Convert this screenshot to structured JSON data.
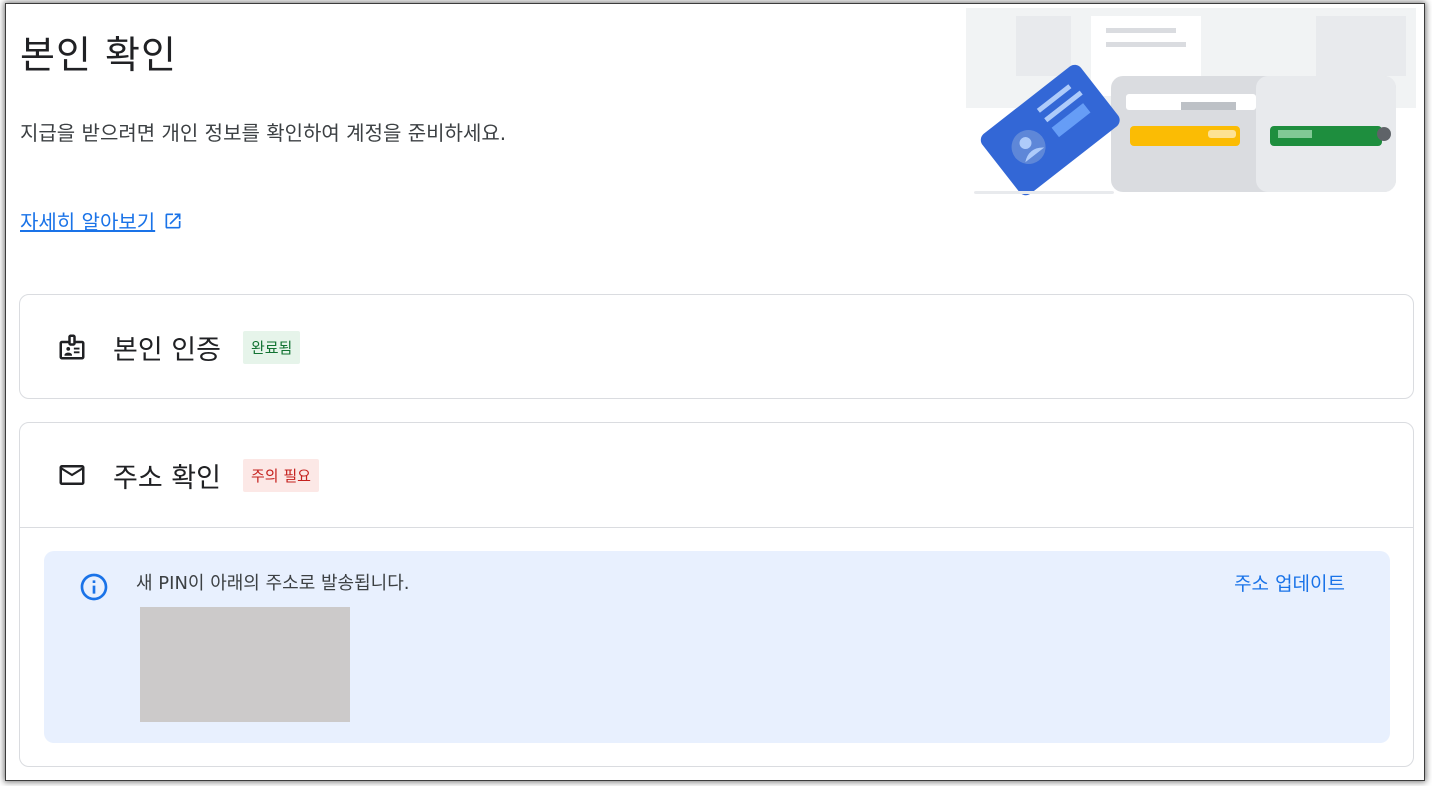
{
  "header": {
    "title": "본인 확인",
    "description": "지급을 받으려면 개인 정보를 확인하여 계정을 준비하세요.",
    "learn_more": "자세히 알아보기"
  },
  "identity": {
    "label": "본인 인증",
    "status": "완료됨"
  },
  "address": {
    "label": "주소 확인",
    "status": "주의 필요",
    "notice": "새 PIN이 아래의 주소로 발송됩니다.",
    "update_link": "주소 업데이트"
  },
  "colors": {
    "link": "#1a73e8",
    "success_bg": "#e6f4ea",
    "success_text": "#137333",
    "warning_bg": "#fce8e6",
    "warning_text": "#c5221f",
    "notice_bg": "#e8f0fe"
  },
  "icons": {
    "identity": "id-badge-icon",
    "address": "mail-icon",
    "info": "info-icon",
    "external": "open-in-new-icon"
  }
}
